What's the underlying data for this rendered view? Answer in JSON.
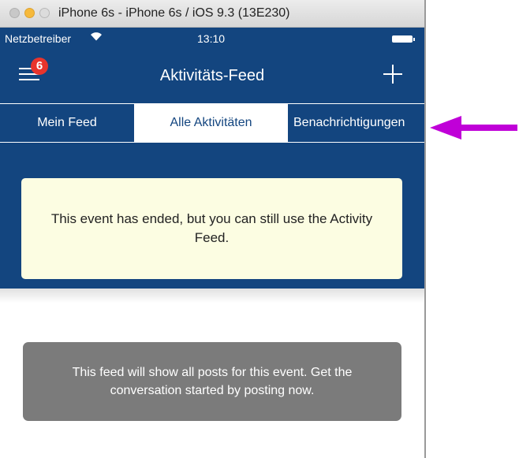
{
  "window": {
    "title": "iPhone 6s - iPhone 6s / iOS 9.3 (13E230)"
  },
  "status_bar": {
    "carrier": "Netzbetreiber",
    "time": "13:10"
  },
  "nav": {
    "badge_count": "6",
    "title": "Aktivitäts-Feed"
  },
  "tabs": [
    {
      "label": "Mein Feed",
      "selected": false
    },
    {
      "label": "Alle Aktivitäten",
      "selected": true
    },
    {
      "label": "Benachrichtigungen",
      "selected": false
    }
  ],
  "notice": {
    "text": "This event has ended, but you can still use the Activity Feed."
  },
  "empty_state": {
    "text": "This feed will show all posts for this event. Get the conversation started by posting now."
  },
  "colors": {
    "brand_blue": "#13457f",
    "notice_bg": "#fcfde2",
    "badge_red": "#e8342c",
    "annotation_arrow": "#c000d8"
  },
  "icons": [
    "hamburger-menu-icon",
    "wifi-icon",
    "battery-icon",
    "plus-icon",
    "annotation-arrow-icon"
  ]
}
